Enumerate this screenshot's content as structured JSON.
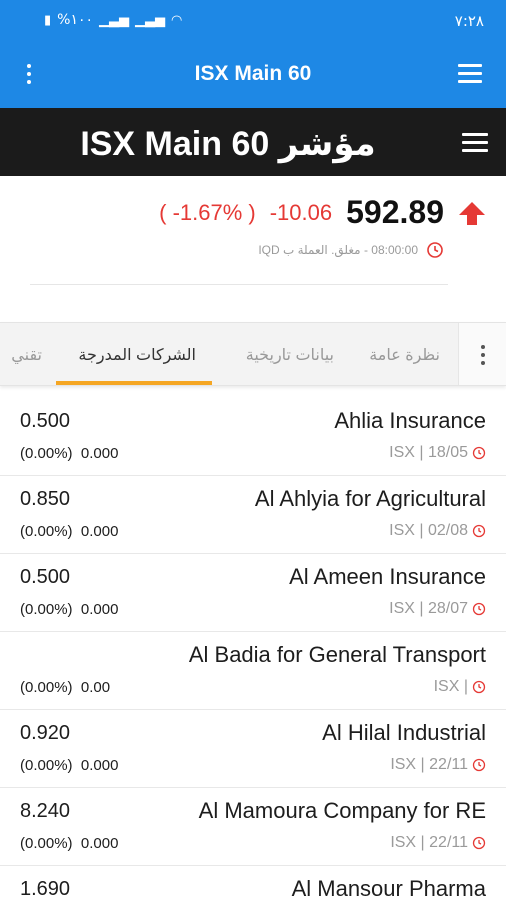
{
  "status_bar": {
    "time": "٧:٢٨",
    "battery": "%١٠٠"
  },
  "app_bar": {
    "title": "ISX Main 60"
  },
  "header": {
    "title": "مؤشر ISX Main 60"
  },
  "quote": {
    "price": "592.89",
    "change": "-10.06",
    "change_percent": "( -1.67% )",
    "status": "08:00:00 - مغلق. العملة ب IQD"
  },
  "tabs": [
    "نظرة عامة",
    "بيانات تاريخية",
    "الشركات المدرجة",
    "تقني"
  ],
  "active_tab": "الشركات المدرجة",
  "colors": {
    "primary": "#1e88e5",
    "header_bg": "#1b1b1b",
    "negative": "#e53935",
    "tab_indicator": "#f5a623"
  },
  "companies": [
    {
      "name": "Ahlia Insurance",
      "meta": "ISX | 18/05",
      "last": "0.500",
      "change": "0.000",
      "percent": "(0.00%)"
    },
    {
      "name": "Al Ahlyia for Agricultural",
      "meta": "ISX | 02/08",
      "last": "0.850",
      "change": "0.000",
      "percent": "(0.00%)"
    },
    {
      "name": "Al Ameen Insurance",
      "meta": "ISX | 28/07",
      "last": "0.500",
      "change": "0.000",
      "percent": "(0.00%)"
    },
    {
      "name": "Al Badia for General Transport",
      "meta": "ISX |",
      "last": "",
      "change": "0.00",
      "percent": "(0.00%)"
    },
    {
      "name": "Al Hilal Industrial",
      "meta": "ISX | 22/11",
      "last": "0.920",
      "change": "0.000",
      "percent": "(0.00%)"
    },
    {
      "name": "Al Mamoura Company for RE",
      "meta": "ISX | 22/11",
      "last": "8.240",
      "change": "0.000",
      "percent": "(0.00%)"
    },
    {
      "name": "Al Mansour Pharma",
      "meta": "",
      "last": "1.690",
      "change": "",
      "percent": ""
    }
  ]
}
